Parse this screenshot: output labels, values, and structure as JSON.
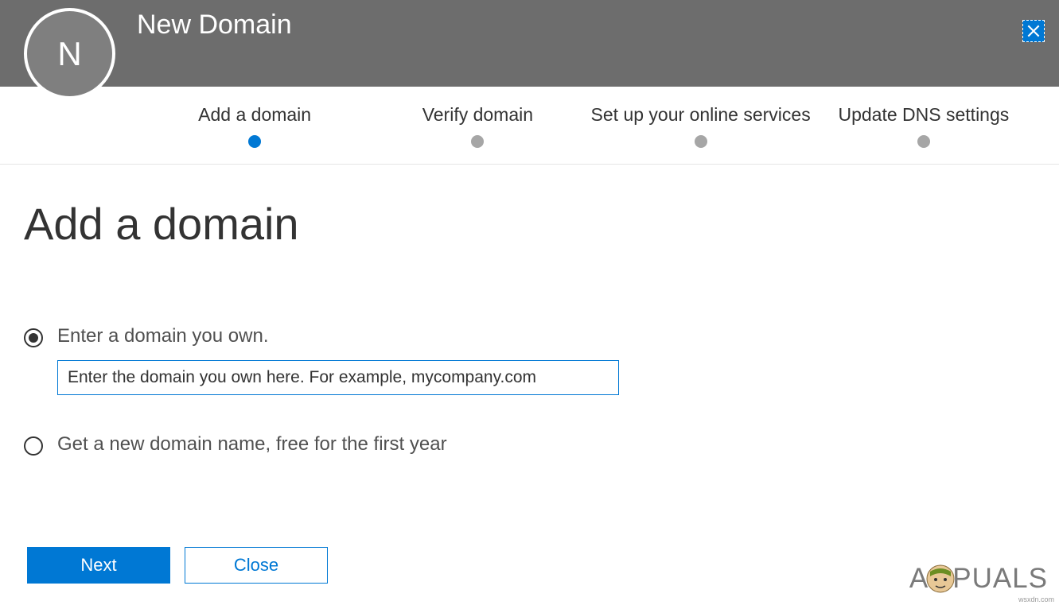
{
  "header": {
    "avatar_letter": "N",
    "title": "New Domain",
    "close_icon": "close"
  },
  "wizard": {
    "steps": [
      {
        "label": "Add a domain",
        "active": true
      },
      {
        "label": "Verify domain",
        "active": false
      },
      {
        "label": "Set up your online services",
        "active": false
      },
      {
        "label": "Update DNS settings",
        "active": false
      }
    ]
  },
  "page": {
    "title": "Add a domain"
  },
  "options": {
    "own_domain": {
      "label": "Enter a domain you own.",
      "selected": true,
      "input_placeholder": "Enter the domain you own here. For example, mycompany.com",
      "input_value": ""
    },
    "new_domain": {
      "label": "Get a new domain name, free for the first year",
      "selected": false
    }
  },
  "buttons": {
    "next": "Next",
    "close": "Close"
  },
  "watermark": {
    "text_a": "A",
    "text_b": "PUALS"
  },
  "credit": "wsxdn.com"
}
